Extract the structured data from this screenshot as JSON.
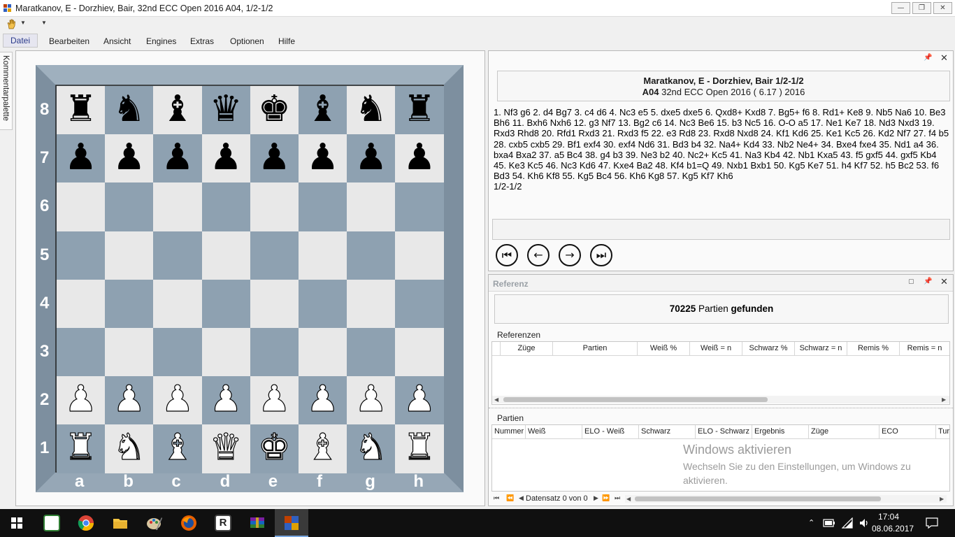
{
  "window": {
    "title": "Maratkanov, E - Dorzhiev, Bair, 32nd ECC Open 2016 A04, 1/2-1/2",
    "minimize": "—",
    "restore": "❐",
    "close": "✕"
  },
  "menu": {
    "items": [
      "Datei",
      "Bearbeiten",
      "Ansicht",
      "Engines",
      "Extras",
      "Optionen",
      "Hilfe"
    ]
  },
  "sidebar": {
    "kommentar_tab": "Kommentarpalette"
  },
  "board": {
    "files": [
      "a",
      "b",
      "c",
      "d",
      "e",
      "f",
      "g",
      "h"
    ],
    "ranks": [
      "8",
      "7",
      "6",
      "5",
      "4",
      "3",
      "2",
      "1"
    ],
    "light_color": "#e8e8e8",
    "dark_color": "#8ea1b1",
    "frame_color": "#8a9cac",
    "position": [
      [
        "bR",
        "bN",
        "bB",
        "bQ",
        "bK",
        "bB",
        "bN",
        "bR"
      ],
      [
        "bP",
        "bP",
        "bP",
        "bP",
        "bP",
        "bP",
        "bP",
        "bP"
      ],
      [
        "",
        "",
        "",
        "",
        "",
        "",
        "",
        ""
      ],
      [
        "",
        "",
        "",
        "",
        "",
        "",
        "",
        ""
      ],
      [
        "",
        "",
        "",
        "",
        "",
        "",
        "",
        ""
      ],
      [
        "",
        "",
        "",
        "",
        "",
        "",
        "",
        ""
      ],
      [
        "wP",
        "wP",
        "wP",
        "wP",
        "wP",
        "wP",
        "wP",
        "wP"
      ],
      [
        "wR",
        "wN",
        "wB",
        "wQ",
        "wK",
        "wB",
        "wN",
        "wR"
      ]
    ]
  },
  "notation": {
    "players": "Maratkanov, E - Dorzhiev, Bair 1/2-1/2",
    "eco": "A04",
    "event": " 32nd ECC Open 2016 ( 6.17 ) 2016",
    "moves": "1. Nf3 g6 2. d4 Bg7 3. c4 d6 4. Nc3 e5 5. dxe5 dxe5 6. Qxd8+ Kxd8 7. Bg5+ f6 8. Rd1+ Ke8 9. Nb5 Na6 10. Be3 Bh6 11. Bxh6 Nxh6 12. g3 Nf7 13. Bg2 c6 14. Nc3 Be6 15. b3 Nc5 16. O-O a5 17. Ne1 Ke7 18. Nd3 Nxd3 19. Rxd3 Rhd8 20. Rfd1 Rxd3 21. Rxd3 f5 22. e3 Rd8 23. Rxd8 Nxd8 24. Kf1 Kd6 25. Ke1 Kc5 26. Kd2 Nf7 27. f4 b5 28. cxb5 cxb5 29. Bf1 exf4 30. exf4 Nd6 31. Bd3 b4 32. Na4+ Kd4 33. Nb2 Ne4+ 34. Bxe4 fxe4 35. Nd1 a4 36. bxa4 Bxa2 37. a5 Bc4 38. g4 b3 39. Ne3 b2 40. Nc2+ Kc5 41. Na3 Kb4 42. Nb1 Kxa5 43. f5 gxf5 44. gxf5 Kb4 45. Ke3 Kc5 46. Nc3 Kd6 47. Kxe4 Ba2 48. Kf4 b1=Q 49. Nxb1 Bxb1 50. Kg5 Ke7 51. h4 Kf7 52. h5 Bc2 53. f6 Bd3 54. Kh6 Kf8 55. Kg5 Bc4 56. Kh6 Kg8 57. Kg5 Kf7 Kh6",
    "result": "1/2-1/2",
    "nav": {
      "first": "⏮",
      "prev": "←",
      "next": "→",
      "last": "⏭"
    }
  },
  "referenz": {
    "title": "Referenz",
    "found_count": "70225",
    "found_mid": " Partien ",
    "found_word": "gefunden",
    "references_label": "Referenzen",
    "references_columns": [
      "Züge",
      "Partien",
      "Weiß %",
      "Weiß = n",
      "Schwarz %",
      "Schwarz = n",
      "Remis %",
      "Remis = n"
    ],
    "games_label": "Partien",
    "games_columns": [
      "Nummer",
      "Weiß",
      "ELO - Weiß",
      "Schwarz",
      "ELO - Schwarz",
      "Ergebnis",
      "Züge",
      "ECO",
      "Tur"
    ],
    "record_label": "Datensatz 0 von 0"
  },
  "watermark": {
    "title": "Windows aktivieren",
    "subtitle": "Wechseln Sie zu den Einstellungen, um Windows zu aktivieren."
  },
  "taskbar": {
    "time": "17:04",
    "date": "08.06.2017",
    "apps": [
      "start-icon",
      "spreadsheet-icon",
      "chrome-icon",
      "file-explorer-icon",
      "paint-icon",
      "firefox-icon",
      "r-app-icon",
      "archive-icon",
      "chess-app-icon"
    ]
  }
}
